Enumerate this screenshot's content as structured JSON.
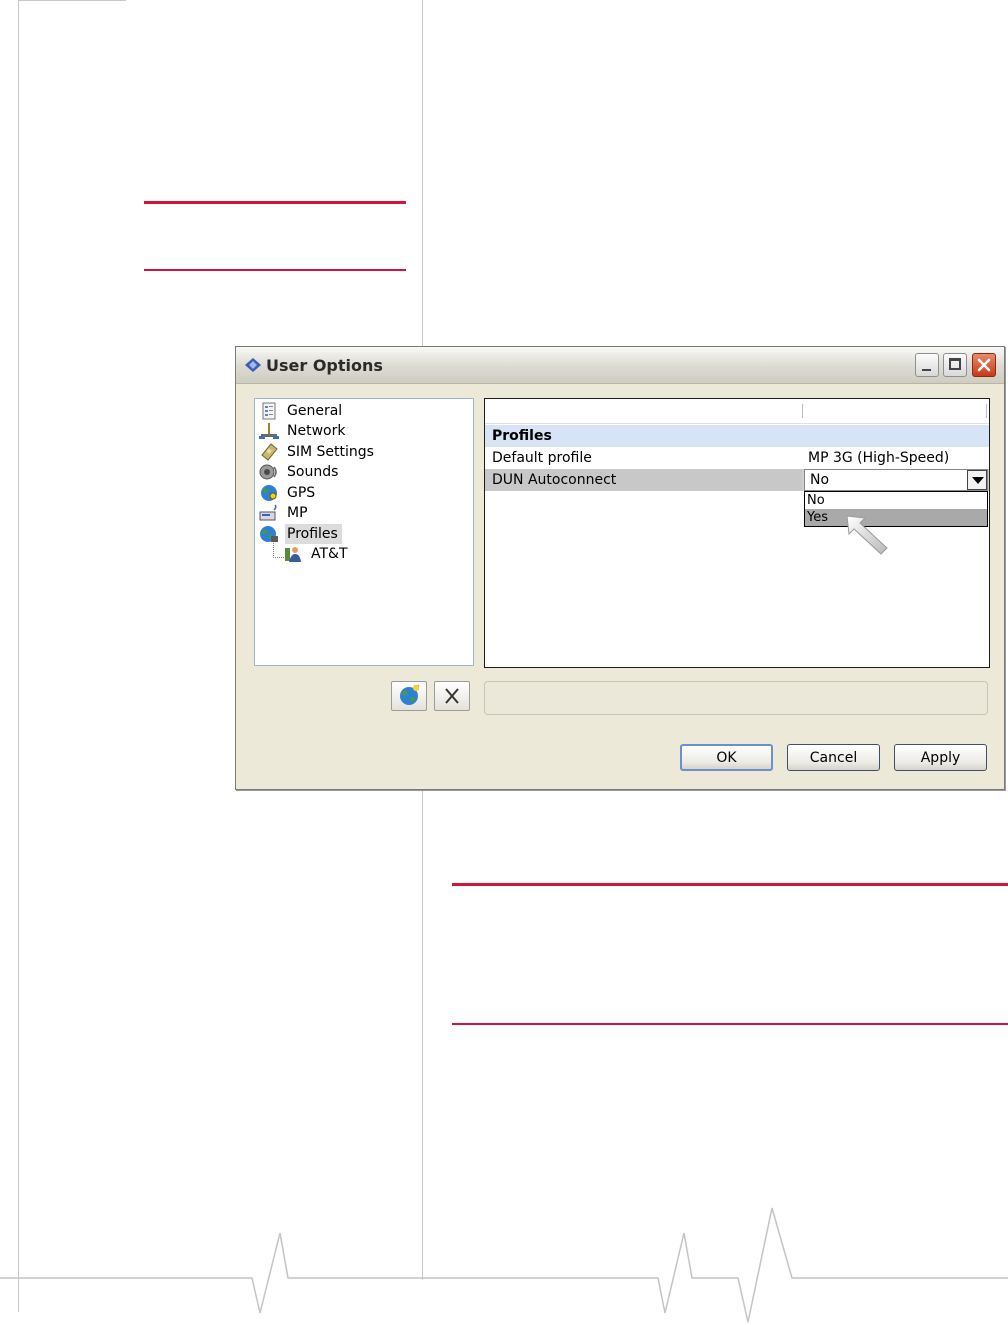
{
  "dialog": {
    "title": "User Options",
    "tree": [
      {
        "label": "General",
        "icon": "general-icon"
      },
      {
        "label": "Network",
        "icon": "network-icon"
      },
      {
        "label": "SIM Settings",
        "icon": "sim-icon"
      },
      {
        "label": "Sounds",
        "icon": "sounds-icon"
      },
      {
        "label": "GPS",
        "icon": "gps-globe-icon"
      },
      {
        "label": "MP",
        "icon": "mp-device-icon"
      },
      {
        "label": "Profiles",
        "icon": "profiles-globe-icon",
        "selected": true
      },
      {
        "label": "AT&T",
        "icon": "profile-person-icon",
        "child": true
      }
    ],
    "grid": {
      "category": "Profiles",
      "rows": [
        {
          "name": "Default profile",
          "value": "MP 3G (High-Speed)"
        },
        {
          "name": "DUN Autoconnect",
          "value": "No"
        }
      ],
      "dropdown_options": [
        "No",
        "Yes"
      ],
      "dropdown_highlighted": "Yes"
    },
    "buttons": {
      "ok": "OK",
      "cancel": "Cancel",
      "apply": "Apply"
    }
  },
  "colors": {
    "accent_rule": "#d4123c",
    "category_bg": "#d6e4f5",
    "dialog_bg": "#ece9d8"
  }
}
